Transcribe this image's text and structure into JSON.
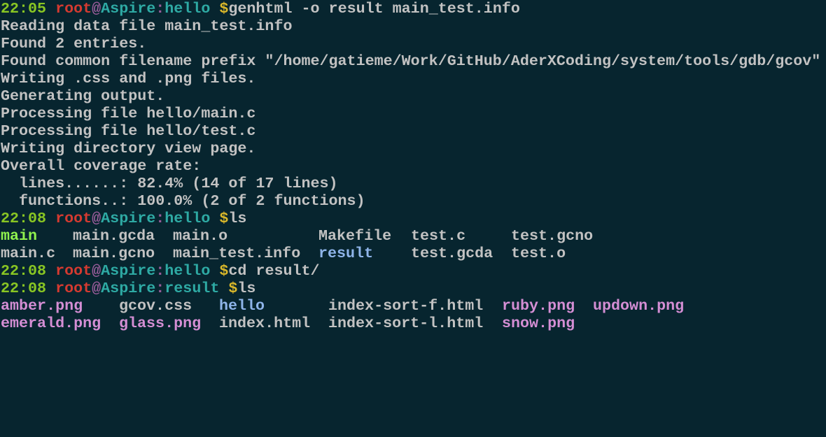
{
  "colors": {
    "background": "#07252f",
    "text": "#c2c2c2",
    "time": "#89c623",
    "user": "#d53a30",
    "at_sign": "#9b5d9b",
    "host_path": "#2eaaa4",
    "dollar": "#d9b72a",
    "executable": "#90f24e",
    "directory": "#8fb5ea",
    "image_file": "#d48ed4"
  },
  "prompts": [
    {
      "time": "22:05 ",
      "user": "root",
      "at": "@",
      "host": "Aspire",
      "sep": ":",
      "cwd": "hello ",
      "dollar": "$",
      "command": "genhtml -o result main_test.info"
    },
    {
      "time": "22:08 ",
      "user": "root",
      "at": "@",
      "host": "Aspire",
      "sep": ":",
      "cwd": "hello ",
      "dollar": "$",
      "command": "ls"
    },
    {
      "time": "22:08 ",
      "user": "root",
      "at": "@",
      "host": "Aspire",
      "sep": ":",
      "cwd": "hello ",
      "dollar": "$",
      "command": "cd result/"
    },
    {
      "time": "22:08 ",
      "user": "root",
      "at": "@",
      "host": "Aspire",
      "sep": ":",
      "cwd": "result ",
      "dollar": "$",
      "command": "ls"
    }
  ],
  "genhtml_output": [
    "Reading data file main_test.info",
    "Found 2 entries.",
    "Found common filename prefix \"/home/gatieme/Work/GitHub/AderXCoding/system/tools/gdb/gcov\"",
    "Writing .css and .png files.",
    "Generating output.",
    "Processing file hello/main.c",
    "Processing file hello/test.c",
    "Writing directory view page.",
    "Overall coverage rate:",
    "  lines......: 82.4% (14 of 17 lines)",
    "  functions..: 100.0% (2 of 2 functions)"
  ],
  "ls_hello": [
    [
      {
        "name": "main",
        "type": "exec"
      },
      {
        "name": "main.gcda",
        "type": "file"
      },
      {
        "name": "main.o",
        "type": "file"
      },
      {
        "name": "Makefile",
        "type": "file"
      },
      {
        "name": "test.c",
        "type": "file"
      },
      {
        "name": "test.gcno",
        "type": "file"
      }
    ],
    [
      {
        "name": "main.c",
        "type": "file"
      },
      {
        "name": "main.gcno",
        "type": "file"
      },
      {
        "name": "main_test.info",
        "type": "file"
      },
      {
        "name": "result",
        "type": "dir"
      },
      {
        "name": "test.gcda",
        "type": "file"
      },
      {
        "name": "test.o",
        "type": "file"
      }
    ]
  ],
  "ls_result": [
    [
      {
        "name": "amber.png",
        "type": "img"
      },
      {
        "name": "gcov.css",
        "type": "file"
      },
      {
        "name": "hello",
        "type": "dir"
      },
      {
        "name": "index-sort-f.html",
        "type": "file"
      },
      {
        "name": "ruby.png",
        "type": "img"
      },
      {
        "name": "updown.png",
        "type": "img"
      }
    ],
    [
      {
        "name": "emerald.png",
        "type": "img"
      },
      {
        "name": "glass.png",
        "type": "img"
      },
      {
        "name": "index.html",
        "type": "file"
      },
      {
        "name": "index-sort-l.html",
        "type": "file"
      },
      {
        "name": "snow.png",
        "type": "img"
      }
    ]
  ]
}
